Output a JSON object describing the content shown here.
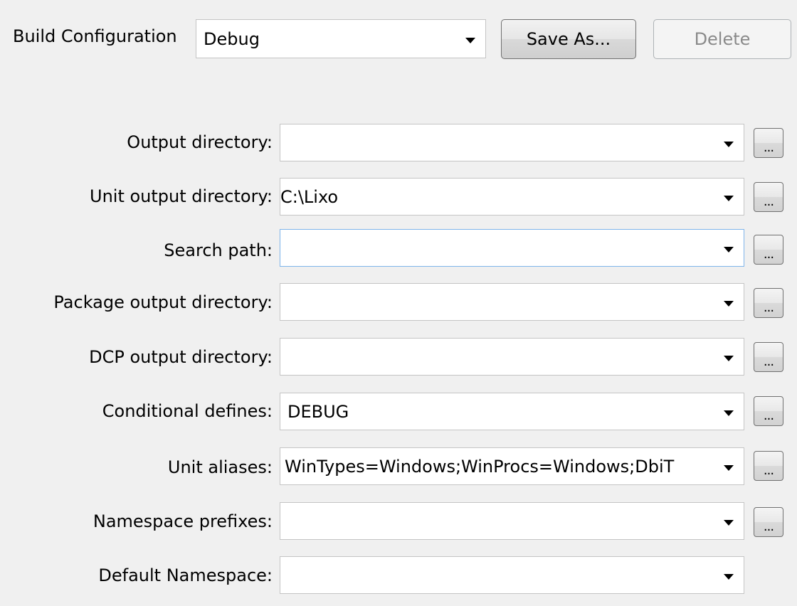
{
  "build_configuration": {
    "label": "Build Configuration",
    "selected": "Debug",
    "save_as_label": "Save As...",
    "delete_label": "Delete"
  },
  "rows": [
    {
      "label": "Output directory:",
      "value": ""
    },
    {
      "label": "Unit output directory:",
      "value": "C:\\Lixo"
    },
    {
      "label": "Search path:",
      "value": ""
    },
    {
      "label": "Package output directory:",
      "value": ""
    },
    {
      "label": "DCP output directory:",
      "value": ""
    },
    {
      "label": "Conditional defines:",
      "value": "DEBUG"
    },
    {
      "label": "Unit aliases:",
      "value": "WinTypes=Windows;WinProcs=Windows;DbiT"
    },
    {
      "label": "Namespace prefixes:",
      "value": ""
    },
    {
      "label": "Default Namespace:",
      "value": ""
    }
  ],
  "ellipsis_label": "...",
  "icons": {
    "dropdown": "chevron-down-icon"
  }
}
